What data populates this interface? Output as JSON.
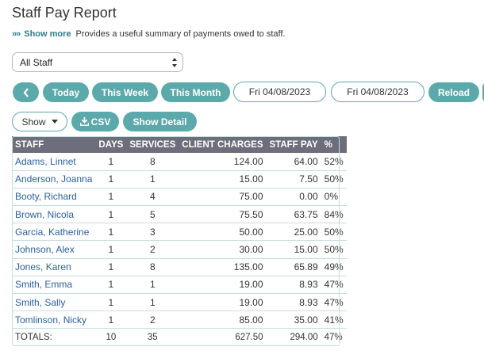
{
  "page": {
    "title": "Staff Pay Report",
    "show_more": "Show more",
    "description": "Provides a useful summary of payments owed to staff."
  },
  "filter": {
    "selected": "All Staff"
  },
  "toolbar": {
    "today": "Today",
    "this_week": "This Week",
    "this_month": "This Month",
    "date_from": "Fri 04/08/2023",
    "date_to": "Fri 04/08/2023",
    "reload": "Reload"
  },
  "actions": {
    "show": "Show",
    "csv": "CSV",
    "show_detail": "Show Detail"
  },
  "colors": {
    "accent": "#5ba9aa",
    "header": "#6c6f7b",
    "link": "#2a5f9e"
  },
  "table": {
    "columns": [
      "STAFF",
      "DAYS",
      "SERVICES",
      "CLIENT CHARGES",
      "STAFF PAY",
      "%"
    ],
    "rows": [
      [
        "Adams, Linnet",
        "1",
        "8",
        "124.00",
        "64.00",
        "52%"
      ],
      [
        "Anderson, Joanna",
        "1",
        "1",
        "15.00",
        "7.50",
        "50%"
      ],
      [
        "Booty, Richard",
        "1",
        "4",
        "75.00",
        "0.00",
        "0%"
      ],
      [
        "Brown, Nicola",
        "1",
        "5",
        "75.50",
        "63.75",
        "84%"
      ],
      [
        "Garcia, Katherine",
        "1",
        "3",
        "50.00",
        "25.00",
        "50%"
      ],
      [
        "Johnson, Alex",
        "1",
        "2",
        "30.00",
        "15.00",
        "50%"
      ],
      [
        "Jones, Karen",
        "1",
        "8",
        "135.00",
        "65.89",
        "49%"
      ],
      [
        "Smith, Emma",
        "1",
        "1",
        "19.00",
        "8.93",
        "47%"
      ],
      [
        "Smith, Sally",
        "1",
        "1",
        "19.00",
        "8.93",
        "47%"
      ],
      [
        "Tomlinson, Nicky",
        "1",
        "2",
        "85.00",
        "35.00",
        "41%"
      ]
    ],
    "totals": [
      "TOTALS:",
      "10",
      "35",
      "627.50",
      "294.00",
      "47%"
    ]
  }
}
